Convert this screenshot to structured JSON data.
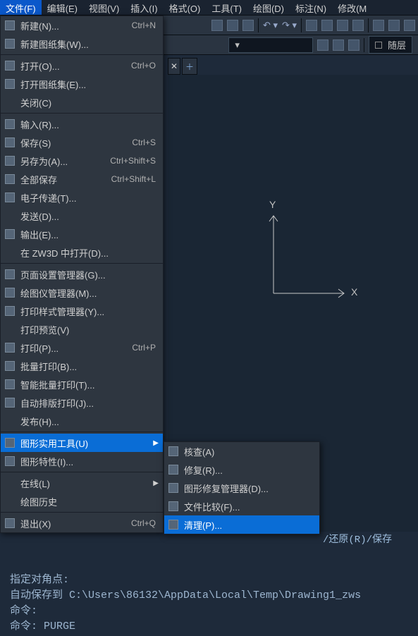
{
  "menubar": [
    {
      "label": "文件(F)",
      "active": true
    },
    {
      "label": "编辑(E)"
    },
    {
      "label": "视图(V)"
    },
    {
      "label": "插入(I)"
    },
    {
      "label": "格式(O)"
    },
    {
      "label": "工具(T)"
    },
    {
      "label": "绘图(D)"
    },
    {
      "label": "标注(N)"
    },
    {
      "label": "修改(M"
    }
  ],
  "toolbar2": {
    "layer_label": "随层"
  },
  "file_menu": [
    {
      "icon": "new-icon",
      "label": "新建(N)...",
      "shortcut": "Ctrl+N"
    },
    {
      "icon": "new-sheetset-icon",
      "label": "新建图纸集(W)..."
    },
    {
      "sep": true
    },
    {
      "icon": "open-icon",
      "label": "打开(O)...",
      "shortcut": "Ctrl+O"
    },
    {
      "icon": "open-sheetset-icon",
      "label": "打开图纸集(E)..."
    },
    {
      "label": "关闭(C)"
    },
    {
      "sep": true
    },
    {
      "icon": "import-icon",
      "label": "输入(R)..."
    },
    {
      "icon": "save-icon",
      "label": "保存(S)",
      "shortcut": "Ctrl+S"
    },
    {
      "icon": "saveas-icon",
      "label": "另存为(A)...",
      "shortcut": "Ctrl+Shift+S"
    },
    {
      "icon": "saveall-icon",
      "label": "全部保存",
      "shortcut": "Ctrl+Shift+L"
    },
    {
      "icon": "etransmit-icon",
      "label": "电子传递(T)..."
    },
    {
      "label": "发送(D)..."
    },
    {
      "icon": "export-icon",
      "label": "输出(E)..."
    },
    {
      "label": "在 ZW3D 中打开(D)..."
    },
    {
      "sep": true
    },
    {
      "icon": "page-setup-icon",
      "label": "页面设置管理器(G)..."
    },
    {
      "icon": "plotter-mgr-icon",
      "label": "绘图仪管理器(M)..."
    },
    {
      "icon": "plot-style-icon",
      "label": "打印样式管理器(Y)..."
    },
    {
      "label": "打印预览(V)"
    },
    {
      "icon": "print-icon",
      "label": "打印(P)...",
      "shortcut": "Ctrl+P"
    },
    {
      "icon": "batch-print-icon",
      "label": "批量打印(B)..."
    },
    {
      "icon": "smart-batch-icon",
      "label": "智能批量打印(T)..."
    },
    {
      "icon": "auto-layout-icon",
      "label": "自动排版打印(J)..."
    },
    {
      "label": "发布(H)..."
    },
    {
      "sep": true
    },
    {
      "icon": "utilities-icon",
      "label": "图形实用工具(U)",
      "submenu": true,
      "highlighted": true
    },
    {
      "icon": "properties-icon",
      "label": "图形特性(I)..."
    },
    {
      "sep": true
    },
    {
      "label": "在线(L)",
      "submenu": true
    },
    {
      "label": "绘图历史"
    },
    {
      "sep": true
    },
    {
      "icon": "exit-icon",
      "label": "退出(X)",
      "shortcut": "Ctrl+Q"
    }
  ],
  "utilities_submenu": [
    {
      "icon": "audit-icon",
      "label": "核查(A)"
    },
    {
      "icon": "recover-icon",
      "label": "修复(R)..."
    },
    {
      "icon": "recover-mgr-icon",
      "label": "图形修复管理器(D)..."
    },
    {
      "icon": "file-compare-icon",
      "label": "文件比较(F)..."
    },
    {
      "icon": "purge-icon",
      "label": "清理(P)...",
      "highlighted": true
    }
  ],
  "axis": {
    "x": "X",
    "y": "Y"
  },
  "prompt_fragment": "/还原(R)/保存",
  "cmdlog": {
    "l1": "指定对角点:",
    "l2": "自动保存到 C:\\Users\\86132\\AppData\\Local\\Temp\\Drawing1_zws",
    "l3": "命令:",
    "l4": "命令: PURGE"
  }
}
